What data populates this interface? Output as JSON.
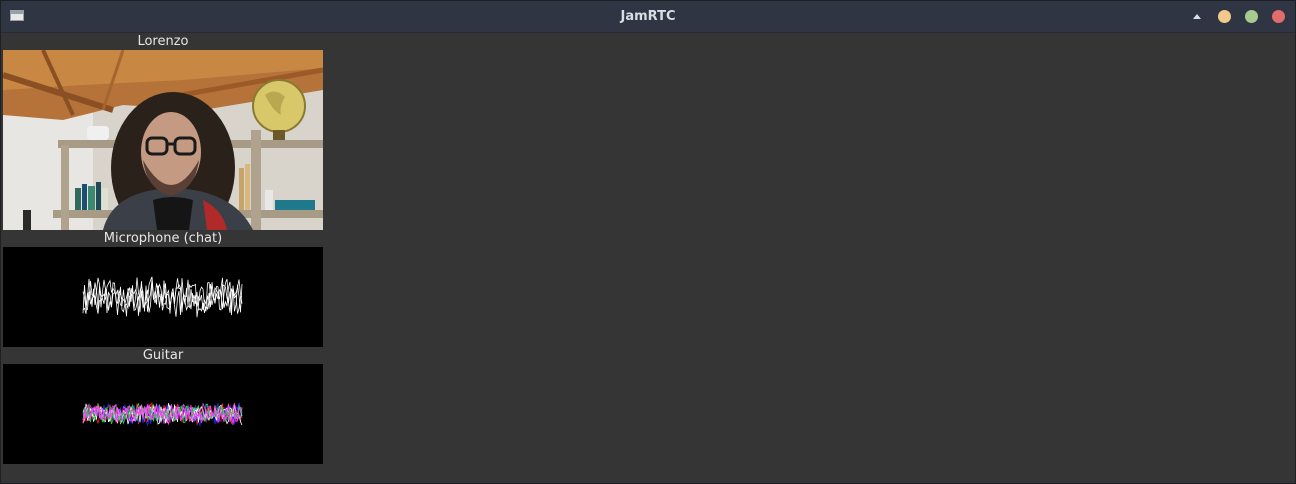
{
  "window": {
    "title": "JamRTC"
  },
  "participant": {
    "name": "Lorenzo"
  },
  "streams": [
    {
      "label": "Microphone (chat)",
      "waveform_colors": [
        "#ffffff"
      ]
    },
    {
      "label": "Guitar",
      "waveform_colors": [
        "#ff2020",
        "#2030ff",
        "#ffffff",
        "#20d040",
        "#ff40ff"
      ]
    }
  ]
}
